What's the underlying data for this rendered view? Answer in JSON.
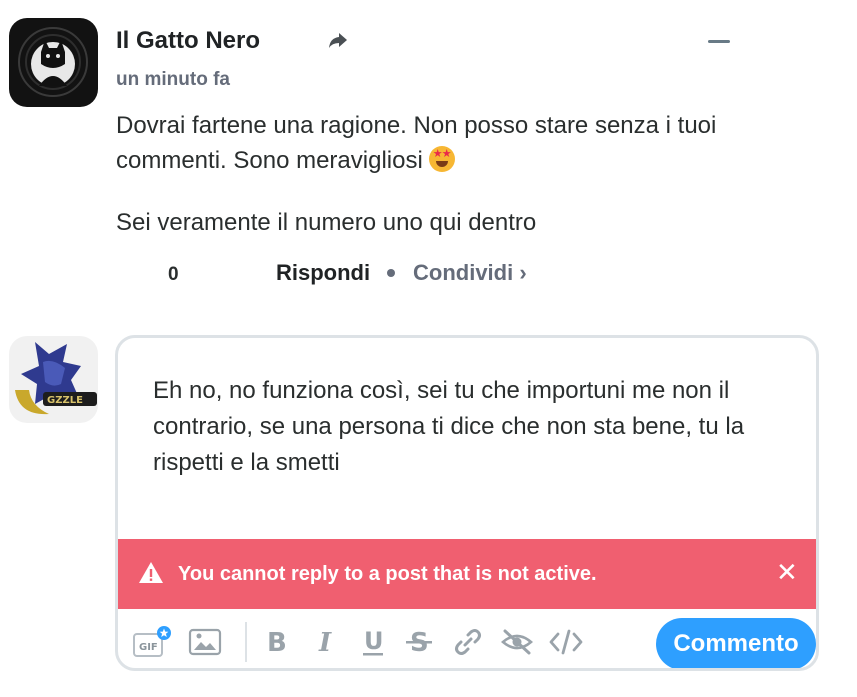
{
  "comment": {
    "author": "Il Gatto Nero",
    "timestamp": "un minuto fa",
    "paragraphs": [
      "Dovrai fartene una ragione. Non posso stare senza i tuoi commenti. Sono meravigliosi",
      "Sei veramente il numero uno qui dentro"
    ],
    "emoji": "star-struck-emoji",
    "votes": "0",
    "reply_label": "Rispondi",
    "share_label": "Condividi ›"
  },
  "reply_box": {
    "draft_text": "Eh no, no funziona così, sei tu che importuni me non il contrario, se una persona ti dice che non sta bene, tu la rispetti e la smetti",
    "alert_text": "You cannot reply to a post that is not active.",
    "alert_close": "✕",
    "submit_label": "Commento",
    "toolbar_icons": [
      "gif-icon",
      "image-icon",
      "bold-icon",
      "italic-icon",
      "underline-icon",
      "strikethrough-icon",
      "link-icon",
      "spoiler-icon",
      "code-icon"
    ]
  },
  "colors": {
    "alert": "#f05f70",
    "submit": "#2e9fff",
    "muted": "#656c7a",
    "text": "#2a2e2e"
  }
}
